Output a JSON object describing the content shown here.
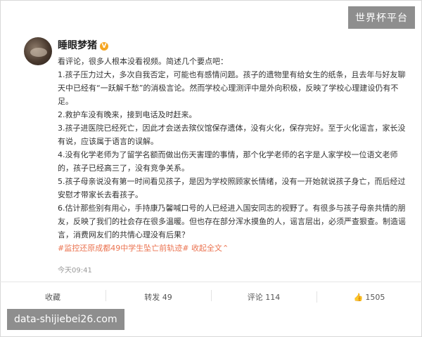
{
  "watermarks": {
    "top": "世界杯平台",
    "bottom": "data-shijiebei26.com"
  },
  "post": {
    "username": "睡眼梦猪",
    "verified_badge": "V",
    "paragraphs": [
      "看评论，很多人根本没看视频。简述几个要点吧：",
      "1.孩子压力过大，多次自我否定，可能也有感情问题。孩子的遗物里有给女生的纸条，且去年与好友聊天中已经有“一跃解千愁”的消极言论。然而学校心理测评中是外向积极，反映了学校心理建设仍有不足。",
      "2.救护车没有晚来，接到电话及时赶来。",
      "3.孩子进医院已经死亡，因此才会送去殡仪馆保存遗体，没有火化，保存完好。至于火化谣言，家长没有说，应该属于语言的误解。",
      "4.没有化学老师为了留学名额而做出伤天害理的事情，那个化学老师的名字是人家学校一位语文老师的，孩子已经高三了，没有竞争关系。",
      "5.孩子母亲说没有第一时间看见孩子，是因为学校照顾家长情绪，没有一开始就说孩子身亡，而后经过安慰才带家长去看孩子。",
      "6.估计那些别有用心，手持康乃馨喊口号的人已经进入国安同志的视野了。有很多与孩子母亲共情的朋友，反映了我们的社会存在很多温暖。但也存在部分浑水摸鱼的人，谣言层出，必须严查狠查。制造谣言，消费网友们的共情心理没有后果？"
    ],
    "hashtag": "#监控还原成都49中学生坠亡前轨迹#",
    "expand_label": "收起全文",
    "expand_arrow": "⌃",
    "timestamp": "今天09:41"
  },
  "actions": {
    "favorite": "收藏",
    "repost": "转发 49",
    "comment": "评论 114",
    "like_icon": "thumb-up-icon",
    "like_count": "1505"
  }
}
